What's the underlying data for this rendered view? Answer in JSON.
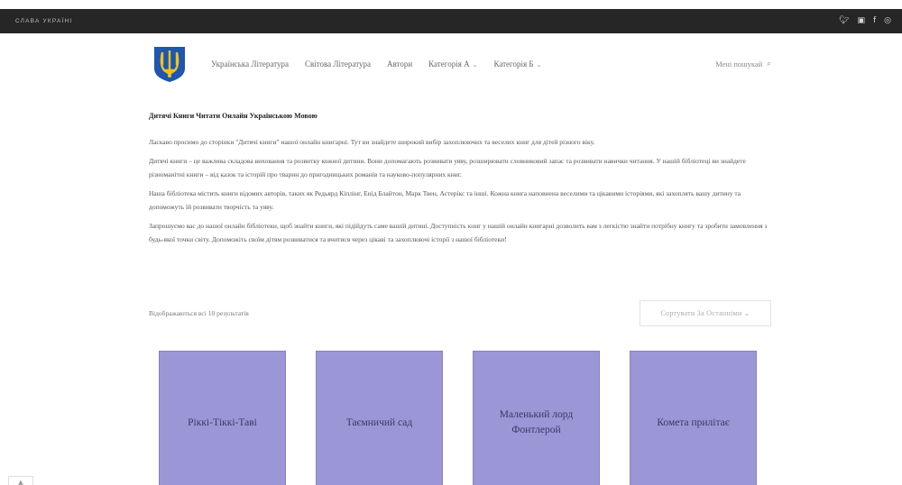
{
  "topbar": {
    "title": "СЛАВА УКРАЇНІ",
    "social": [
      {
        "name": "twitter-icon",
        "glyph": "𝕏"
      },
      {
        "name": "instagram-icon",
        "glyph": "◙"
      },
      {
        "name": "facebook-icon",
        "glyph": "f"
      },
      {
        "name": "pinterest-icon",
        "glyph": "◎"
      }
    ]
  },
  "header": {
    "nav": [
      {
        "label": "Українська Література",
        "dropdown": false
      },
      {
        "label": "Світова Література",
        "dropdown": false
      },
      {
        "label": "Автори",
        "dropdown": false
      },
      {
        "label": "Категорія А",
        "dropdown": true
      },
      {
        "label": "Категорія Б",
        "dropdown": true
      }
    ],
    "search_label": "Мені пошукай"
  },
  "main": {
    "title": "Дитячі Книги Читати Онлайн Українською Мовою",
    "paragraphs": [
      "Ласкаво просимо до сторінки \"Дитячі книги\" нашої онлайн книгарні. Тут ви знайдете широкий вибір захоплюючих та веселих книг для дітей різного віку.",
      "Дитячі книги – це важлива складова виховання та розвитку кожної дитини. Вони допомагають розвивати уяву, розширювати словниковий запас та розвивати навички читання. У нашій бібліотеці ви знайдете різноманітні книги – від казок та історій про тварин до пригодницьких романів та науково-популярних книг.",
      "Наша бібліотека містить книги відомих авторів, таких як Редьярд Кіплінг, Енід Блайтон, Марк Твен, Астерікс та інші. Кожна книга наповнена веселими та цікавими історіями, які захоплять вашу дитину та допоможуть їй розвивати творчість та уяву.",
      "Запрошуємо вас до нашої онлайн бібліотеки, щоб знайти книги, які підійдуть саме вашій дитині. Доступність книг у нашій онлайн книгарні дозволить вам з легкістю знайти потрібну книгу та зробити замовлення з будь-якої точки світу. Допоможіть своїм дітям розвиватися та вчитися через цікаві та захоплюючі історії з нашої бібліотеки!"
    ]
  },
  "results": {
    "count_text": "Відображаються всі 10 результатів",
    "sort_label": "Сортувати За Останніми"
  },
  "books": [
    {
      "title": "Ріккі-Тіккі-Таві"
    },
    {
      "title": "Таємничий сад"
    },
    {
      "title": "Маленький лорд Фонтлерой"
    },
    {
      "title": "Комета прилітає"
    }
  ],
  "colors": {
    "topbar": "#262626",
    "book_cover": "#9b97d6",
    "logo_blue": "#1e56b0",
    "logo_yellow": "#f2c21b"
  }
}
